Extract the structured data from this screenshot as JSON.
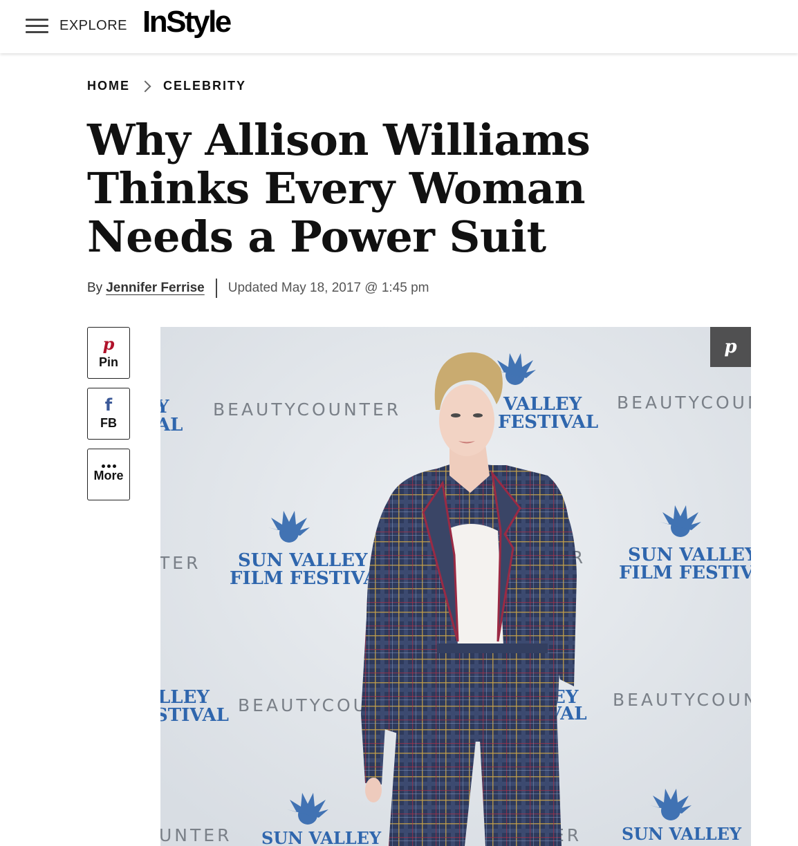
{
  "header": {
    "menu_icon": "hamburger-menu-icon",
    "explore_label": "EXPLORE",
    "logo": "InStyle"
  },
  "breadcrumb": {
    "items": [
      {
        "label": "HOME"
      },
      {
        "label": "CELEBRITY"
      }
    ],
    "separator_icon": "chevron-right-icon"
  },
  "article": {
    "title": "Why Allison Williams Thinks Every Woman Needs a Power Suit",
    "byline_prefix": "By",
    "author": "Jennifer Ferrise",
    "updated": "Updated May 18, 2017 @ 1:45 pm"
  },
  "share": {
    "buttons": [
      {
        "label": "Pin",
        "icon": "pinterest-icon",
        "color": "#b0122a"
      },
      {
        "label": "FB",
        "icon": "facebook-icon",
        "color": "#3b5998"
      },
      {
        "label": "More",
        "icon": "more-dots-icon",
        "color": "#111111"
      }
    ]
  },
  "hero_image": {
    "pin_icon": "pinterest-icon",
    "backdrop_text": {
      "brand": "BEAUTYCOUNTER",
      "brand_fragments": [
        "BEAUTYCOU",
        "BEAUTYCOUN",
        "TER",
        "ER",
        "UNTER",
        "NTER",
        "UT"
      ],
      "festival_line1": "SUN VALLEY",
      "festival_line2": "FILM FESTIVAL",
      "festival_fragments": [
        "VALLEY",
        "FESTIVAL",
        "Y",
        "AL",
        "LLEY",
        "STIVAL",
        "EY",
        "VAL"
      ]
    }
  }
}
